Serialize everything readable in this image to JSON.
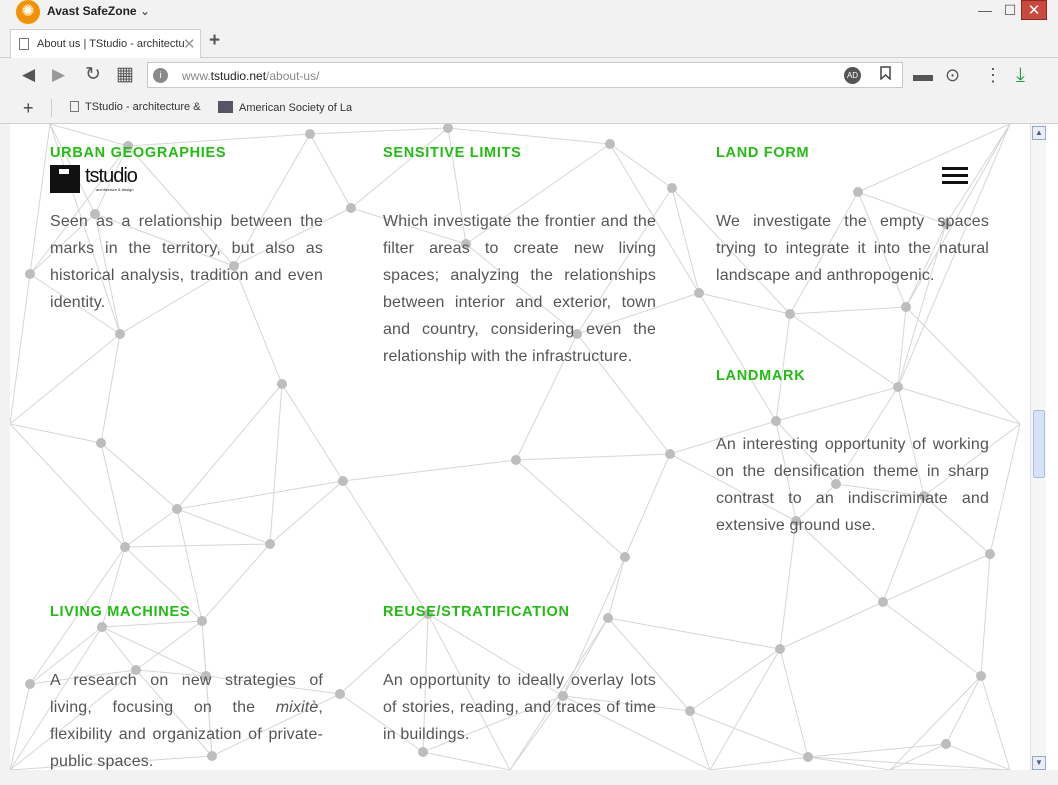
{
  "window": {
    "app_name": "Avast SafeZone",
    "dropdown_glyph": "⌄",
    "minimize_glyph": "—",
    "maximize_glyph": "☐",
    "close_glyph": "✕"
  },
  "tabs": [
    {
      "title": "About us | TStudio - architecture",
      "close_glyph": "✕"
    }
  ],
  "new_tab_glyph": "+",
  "toolbar": {
    "back_glyph": "◀",
    "forward_glyph": "▶",
    "reload_glyph": "↻",
    "apps_glyph": "▦",
    "url_prefix": "www.",
    "url_domain": "tstudio.net",
    "url_path": "/about-us/",
    "ad_badge": "AD",
    "bookmark_glyph": "🔖",
    "wallet_glyph": "▬",
    "password_glyph": "⊙",
    "menu_glyph": "⋮",
    "download_glyph": "⤓"
  },
  "bookmarks_bar": {
    "add_glyph": "+",
    "items": [
      {
        "label": "TStudio - architecture &"
      },
      {
        "label": "American Society of La"
      }
    ]
  },
  "site": {
    "logo_text": "tstudio",
    "logo_subtext": "architecture & design",
    "sections": [
      {
        "title": "URBAN GEOGRAPHIES",
        "body": "Seen as a relationship between the marks in the territory, but also as historical analysis, tradition and even identity."
      },
      {
        "title": "SENSITIVE LIMITS",
        "body": "Which investigate the frontier and the filter areas to create  new living spaces; analyzing the relationships between interior and exterior, town and country, considering even the relationship with the infrastructure."
      },
      {
        "title": "LAND FORM",
        "body": "We investigate the empty spaces trying to integrate it into the natural landscape and anthropogenic."
      },
      {
        "title": "LANDMARK",
        "body": "An interesting opportunity of working on the densification theme in sharp contrast to an indiscriminate and extensive ground use."
      },
      {
        "title": "LIVING MACHINES",
        "body_before": "A research on new strategies of living, focusing on the ",
        "body_italic": "mixitè",
        "body_after": ", flexibility and organization of private-public spaces."
      },
      {
        "title": "REUSE/STRATIFICATION",
        "body": "An opportunity to ideally overlay lots of stories, reading, and traces of time in buildings."
      }
    ]
  },
  "colors": {
    "accent_green": "#21bd10",
    "body_text": "#555555",
    "mesh_line": "#d6d6d6",
    "mesh_node": "#bdbdbd",
    "close_button": "#c9493e",
    "avast_orange": "#f39200"
  },
  "scrollbar": {
    "up_glyph": "▲",
    "down_glyph": "▼"
  }
}
